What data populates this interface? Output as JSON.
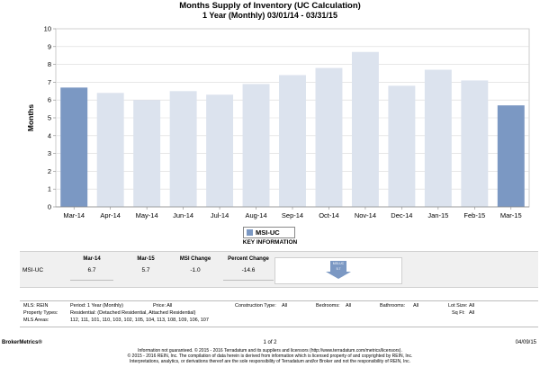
{
  "header": {
    "title": "Months Supply of Inventory (UC Calculation)",
    "subtitle": "1 Year (Monthly) 03/01/14 - 03/31/15"
  },
  "chart_data": {
    "type": "bar",
    "title": "Months Supply of Inventory (UC Calculation)",
    "subtitle": "1 Year (Monthly) 03/01/14 - 03/31/15",
    "xlabel": "",
    "ylabel": "Months",
    "ylim": [
      0,
      10
    ],
    "yticks": [
      0,
      1,
      2,
      3,
      4,
      5,
      6,
      7,
      8,
      9,
      10
    ],
    "grid": true,
    "legend": "bottom-center",
    "categories": [
      "Mar-14",
      "Apr-14",
      "May-14",
      "Jun-14",
      "Jul-14",
      "Aug-14",
      "Sep-14",
      "Oct-14",
      "Nov-14",
      "Dec-14",
      "Jan-15",
      "Feb-15",
      "Mar-15"
    ],
    "series": [
      {
        "name": "MSI-UC",
        "values": [
          6.7,
          6.4,
          6.0,
          6.5,
          6.3,
          6.9,
          7.4,
          7.8,
          8.7,
          6.8,
          7.7,
          7.1,
          5.7
        ]
      }
    ],
    "highlighted": [
      0,
      12
    ],
    "colors": {
      "highlight": "#7b98c3",
      "normal": "#dce3ee"
    }
  },
  "key_info": {
    "title": "KEY INFORMATION",
    "columns": [
      "Mar-14",
      "Mar-15",
      "MSI Change",
      "Percent Change"
    ],
    "row_label": "MSI-UC",
    "values": [
      "6.7",
      "5.7",
      "-1.0",
      "-14.6"
    ],
    "mini_label": "MSI-UC 5.7"
  },
  "criteria": {
    "mls": "MLS:  REIN",
    "period": "Period:  1 Year (Monthly)",
    "price": "Price:  All",
    "construction": "Construction Type:",
    "construction_val": "All",
    "bedrooms": "Bedrooms:",
    "bedrooms_val": "All",
    "bathrooms": "Bathrooms:",
    "bathrooms_val": "All",
    "lot_size": "Lot Size:",
    "lot_size_val": "All",
    "sqft": "Sq Ft:",
    "sqft_val": "All",
    "property_types_label": "Property Types:",
    "property_types": "Residential: (Detached Residential, Attached Residential)",
    "mls_areas_label": "MLS Areas:",
    "mls_areas": "112, 111, 101, 110, 103, 102, 105, 104, 113, 108, 109, 106, 107"
  },
  "footer": {
    "brand": "BrokerMetrics®",
    "page": "1 of 2",
    "date": "04/09/15",
    "disclaimer_1": "Information not guaranteed. © 2015 - 2016 Terradatum and its suppliers and licensors (http://www.terradatum.com/metrics/licensors).",
    "disclaimer_2": "© 2015 - 2016 REIN, Inc. The compilation of data herein is derived from information which is licensed property of and copyrighted by REIN, Inc.",
    "disclaimer_3": "Interpretations, analytics, or derivations thereof are the sole responsibility of Terradatum and/or Broker and not the responsibility of REIN, Inc."
  }
}
